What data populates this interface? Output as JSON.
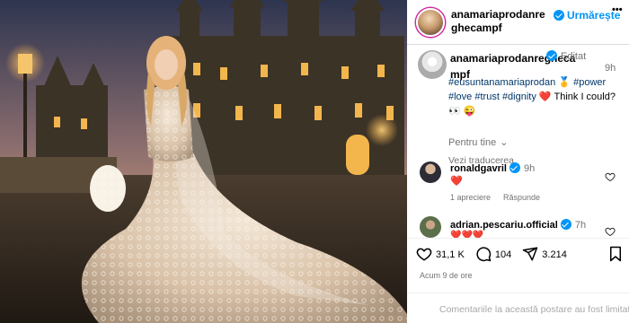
{
  "post": {
    "image_alt": "Bride in lace wedding gown in front of a castle at dusk"
  },
  "header": {
    "username": "anamariaprodanreghecampf",
    "follow_label": "Urmărește",
    "more_label": "•••"
  },
  "caption": {
    "username": "anamariaprodanreghecampf",
    "edited_label": "Editat",
    "time": "9h",
    "hashtag_1": "#eusuntanamariaprodan",
    "emoji_medal": "🥇",
    "hashtag_2": "#power",
    "hashtag_3": "#love",
    "hashtag_4": "#trust",
    "hashtag_5": "#dignity",
    "emoji_heart": "❤️",
    "text": "Think I could?",
    "emoji_eyes": "👀",
    "emoji_wink": "😜",
    "see_translation": "Vezi traducerea"
  },
  "filter": {
    "label": "Pentru tine",
    "chevron": "⌄"
  },
  "comments": [
    {
      "username": "ronaldgavril",
      "time": "9h",
      "text": "❤️",
      "likes_label": "1 apreciere",
      "reply_label": "Răspunde"
    },
    {
      "username": "adrian.pescariu.official",
      "time": "7h",
      "text": "❤️❤️❤️"
    }
  ],
  "actions": {
    "likes": "31,1 K",
    "comments": "104",
    "shares": "3.214",
    "timestamp": "Acum 9 de ore",
    "comments_limited": "Comentariile la această postare au fost limitate."
  },
  "colors": {
    "accent": "#0095f6",
    "hashtag": "#00376b",
    "heart": "#ed4956",
    "muted": "#737373"
  },
  "icons": {
    "like": "heart-icon",
    "comment": "comment-icon",
    "share": "share-icon",
    "save": "bookmark-icon",
    "verified": "verified-badge-icon",
    "more": "more-options-icon"
  }
}
